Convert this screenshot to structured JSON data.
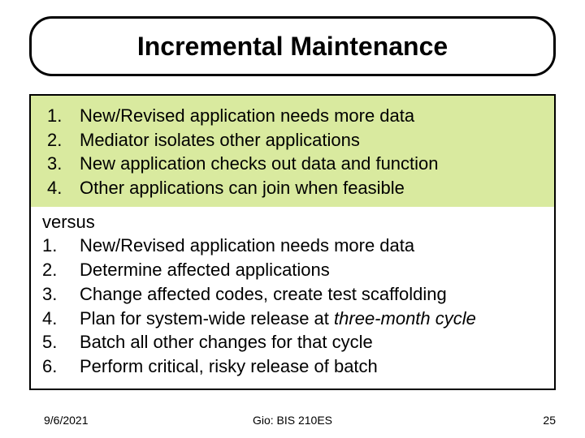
{
  "title": "Incremental Maintenance",
  "top_list": [
    {
      "num": "1.",
      "text": "New/Revised application needs more data"
    },
    {
      "num": "2.",
      "text": "Mediator isolates other applications"
    },
    {
      "num": "3.",
      "text": "New application checks out data and function"
    },
    {
      "num": "4.",
      "text": "Other applications can join when feasible"
    }
  ],
  "versus": "versus",
  "bottom_list": [
    {
      "num": "1.",
      "text": "New/Revised application needs more data"
    },
    {
      "num": "2.",
      "text": "Determine affected applications"
    },
    {
      "num": "3.",
      "text": "Change affected codes, create test scaffolding"
    },
    {
      "num": "4.",
      "text_parts": [
        "Plan for system-wide release at ",
        "three-month cycle"
      ]
    },
    {
      "num": "5.",
      "text": "Batch all other changes for that cycle"
    },
    {
      "num": "6.",
      "text": "Perform critical, risky release of batch"
    }
  ],
  "footer": {
    "date": "9/6/2021",
    "center": "Gio: BIS 210ES",
    "page": "25"
  }
}
